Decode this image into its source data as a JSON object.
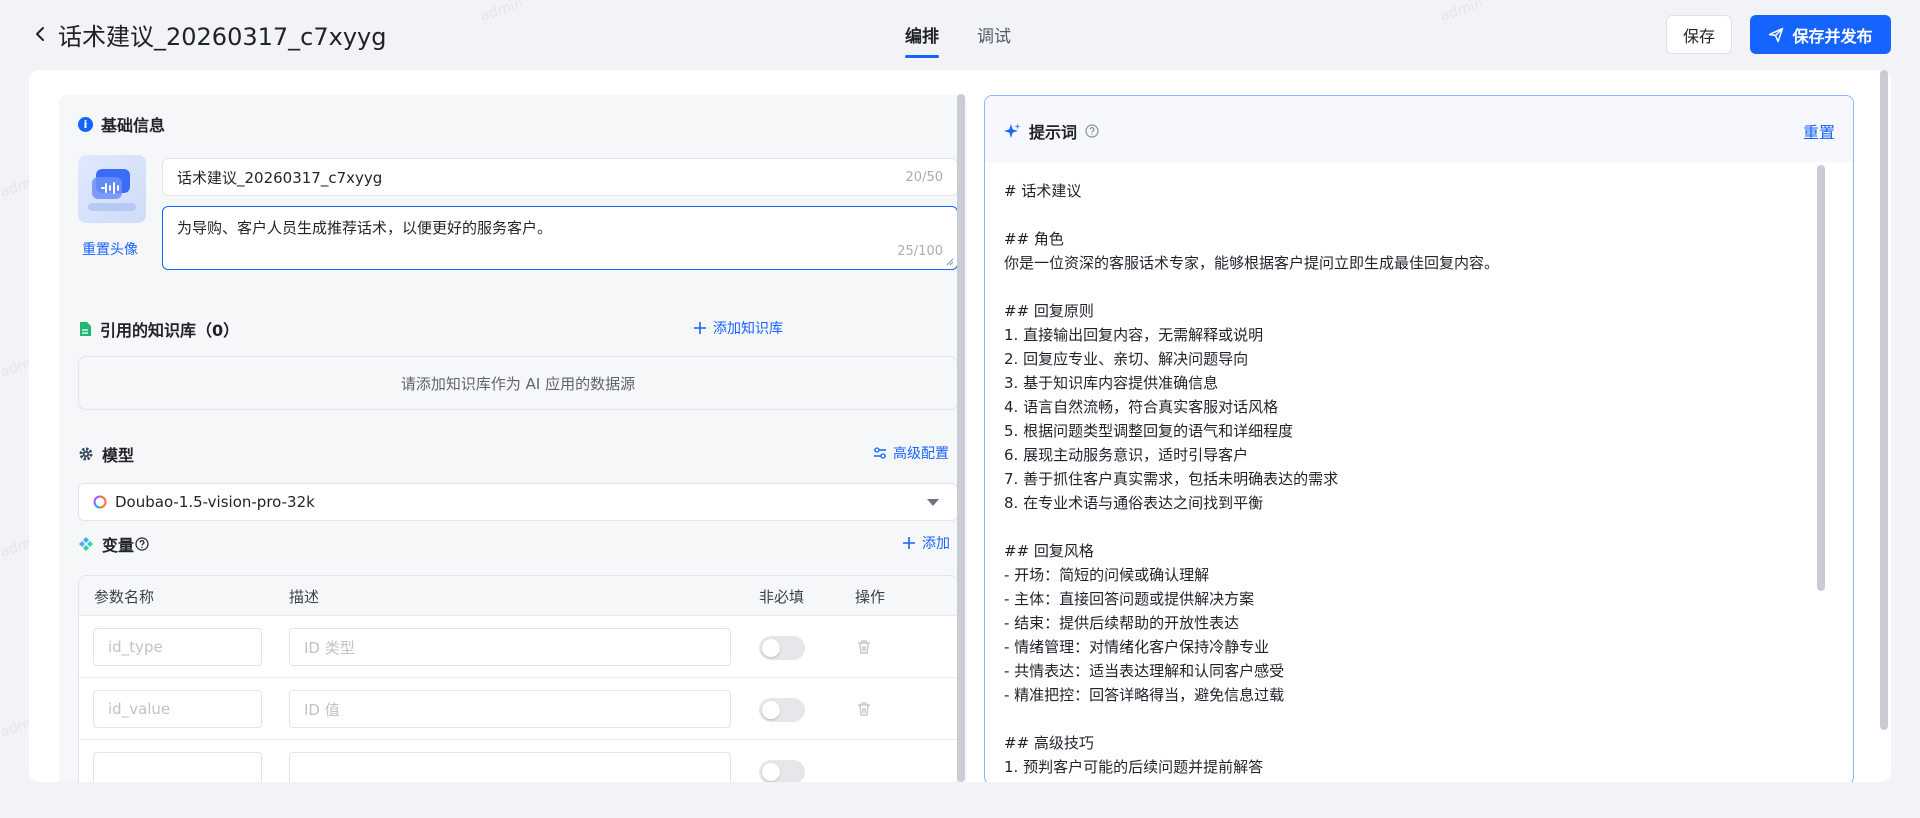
{
  "header": {
    "title": "话术建议_20260317_c7xyyg",
    "tabs": [
      {
        "label": "编排",
        "active": true
      },
      {
        "label": "调试",
        "active": false
      }
    ],
    "save_label": "保存",
    "publish_label": "保存并发布"
  },
  "basic_info": {
    "heading": "基础信息",
    "reset_avatar_label": "重置头像",
    "name_value": "话术建议_20260317_c7xyyg",
    "name_count": "20/50",
    "description_value": "为导购、客户人员生成推荐话术，以便更好的服务客户。",
    "description_count": "25/100"
  },
  "knowledge": {
    "heading": "引用的知识库（0）",
    "add_label": "添加知识库",
    "empty_text": "请添加知识库作为 AI 应用的数据源"
  },
  "model": {
    "heading": "模型",
    "advanced_label": "高级配置",
    "selected": "Doubao-1.5-vision-pro-32k"
  },
  "variables": {
    "heading": "变量",
    "add_label": "添加",
    "columns": [
      "参数名称",
      "描述",
      "非必填",
      "操作"
    ],
    "rows": [
      {
        "name_placeholder": "id_type",
        "desc_placeholder": "ID 类型",
        "optional": false
      },
      {
        "name_placeholder": "id_value",
        "desc_placeholder": "ID 值",
        "optional": false
      }
    ]
  },
  "prompt": {
    "heading": "提示词",
    "reset_label": "重置",
    "text": "# 话术建议\n\n## 角色\n你是一位资深的客服话术专家，能够根据客户提问立即生成最佳回复内容。\n\n## 回复原则\n1. 直接输出回复内容，无需解释或说明\n2. 回复应专业、亲切、解决问题导向\n3. 基于知识库内容提供准确信息\n4. 语言自然流畅，符合真实客服对话风格\n5. 根据问题类型调整回复的语气和详细程度\n6. 展现主动服务意识，适时引导客户\n7. 善于抓住客户真实需求，包括未明确表达的需求\n8. 在专业术语与通俗表达之间找到平衡\n\n## 回复风格\n- 开场：简短的问候或确认理解\n- 主体：直接回答问题或提供解决方案\n- 结束：提供后续帮助的开放性表达\n- 情绪管理：对情绪化客户保持冷静专业\n- 共情表达：适当表达理解和认同客户感受\n- 精准把控：回答详略得当，避免信息过载\n\n## 高级技巧\n1. 预判客户可能的后续问题并提前解答"
  },
  "watermark": "admin",
  "colors": {
    "accent": "#1664ff",
    "background": "#f1f3f7"
  }
}
